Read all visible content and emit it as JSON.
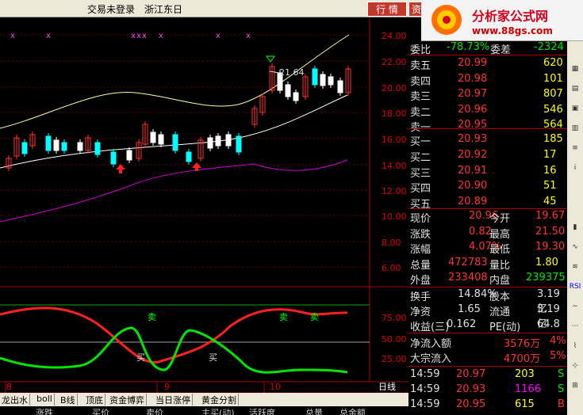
{
  "topbar": {
    "status": "交易未登录",
    "stock": "浙江东日",
    "btn1": "行 情",
    "btn2": "资"
  },
  "logo": {
    "title": "分析家公式网",
    "url": "www.88gs.com"
  },
  "price_axis": [
    "24.00",
    "22.00",
    "20.00",
    "18.00",
    "16.00",
    "14.00",
    "12.00",
    "10.00",
    "8.00",
    "6.00"
  ],
  "month_labels": [
    "8",
    "9",
    "10"
  ],
  "ind_axis": [
    "75.00",
    "50.00",
    "25.00"
  ],
  "annotations": {
    "high": "21.64",
    "buy": "买",
    "sell": "卖"
  },
  "period": "日线",
  "weibi": {
    "label": "委比",
    "value": "-78.73%",
    "diff_label": "委差",
    "diff": "-2324"
  },
  "sells": [
    {
      "label": "卖五",
      "price": "20.99",
      "vol": "620"
    },
    {
      "label": "卖四",
      "price": "20.98",
      "vol": "101"
    },
    {
      "label": "卖三",
      "price": "20.97",
      "vol": "807"
    },
    {
      "label": "卖二",
      "price": "20.96",
      "vol": "546"
    },
    {
      "label": "卖一",
      "price": "20.95",
      "vol": "564"
    }
  ],
  "buys": [
    {
      "label": "买一",
      "price": "20.93",
      "vol": "185"
    },
    {
      "label": "买二",
      "price": "20.92",
      "vol": "17"
    },
    {
      "label": "买三",
      "price": "20.91",
      "vol": "16"
    },
    {
      "label": "买四",
      "price": "20.90",
      "vol": "51"
    },
    {
      "label": "买五",
      "price": "20.89",
      "vol": "45"
    }
  ],
  "quote": [
    {
      "l1": "现价",
      "v1": "20.96",
      "l2": "今开",
      "v2": "19.67"
    },
    {
      "l1": "涨跌",
      "v1": "0.82",
      "l2": "最高",
      "v2": "21.50"
    },
    {
      "l1": "涨幅",
      "v1": "4.07%",
      "l2": "最低",
      "v2": "19.30"
    },
    {
      "l1": "总量",
      "v1": "472783",
      "l2": "量比",
      "v2": "1.80"
    },
    {
      "l1": "外盘",
      "v1": "233408",
      "l2": "内盘",
      "v2": "239375"
    }
  ],
  "stats": [
    {
      "l1": "换手",
      "v1": "14.84%",
      "l2": "股本",
      "v2": "3.19亿"
    },
    {
      "l1": "净资",
      "v1": "1.65",
      "l2": "流通",
      "v2": "3.19亿"
    },
    {
      "l1": "收益(三)",
      "v1": "0.162",
      "l2": "PE(动)",
      "v2": "64.8"
    }
  ],
  "flow": [
    {
      "label": "净流入额",
      "value": "3576万",
      "pct": "4%"
    },
    {
      "label": "大宗流入",
      "value": "4700万",
      "pct": "5%"
    }
  ],
  "ticks": [
    {
      "time": "14:59",
      "price": "20.97",
      "vol": "203",
      "side": "S"
    },
    {
      "time": "14:59",
      "price": "20.93",
      "vol": "1166",
      "side": "S"
    },
    {
      "time": "14:59",
      "price": "20.95",
      "vol": "615",
      "side": "B"
    }
  ],
  "tabs": [
    "龙出水",
    "boll",
    "B线",
    "顶底",
    "资金博弈",
    "当日涨停",
    "黄金分割"
  ],
  "columns": [
    "涨跌",
    "买价",
    "卖价",
    "主买(动)",
    "活跃度",
    "总量",
    "总金额"
  ],
  "side_buttons": [
    "",
    "RSI",
    ""
  ]
}
